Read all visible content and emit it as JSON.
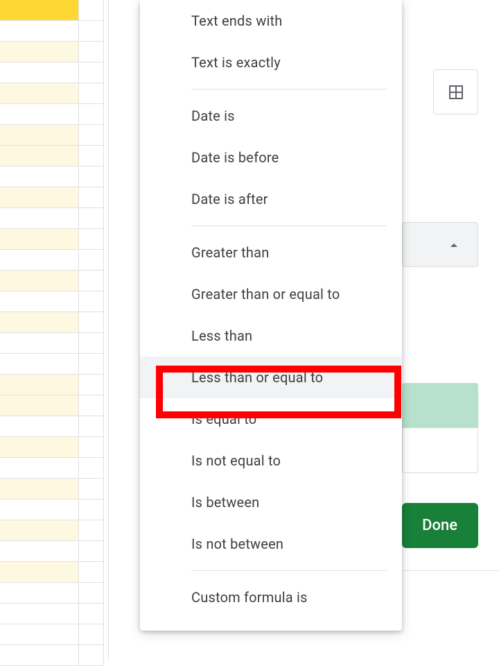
{
  "dropdown": {
    "groups": [
      {
        "items": [
          {
            "id": "text-ends-with",
            "label": "Text ends with"
          },
          {
            "id": "text-is-exactly",
            "label": "Text is exactly"
          }
        ]
      },
      {
        "items": [
          {
            "id": "date-is",
            "label": "Date is"
          },
          {
            "id": "date-is-before",
            "label": "Date is before"
          },
          {
            "id": "date-is-after",
            "label": "Date is after"
          }
        ]
      },
      {
        "items": [
          {
            "id": "greater-than",
            "label": "Greater than"
          },
          {
            "id": "greater-than-or-equal-to",
            "label": "Greater than or equal to"
          },
          {
            "id": "less-than",
            "label": "Less than"
          },
          {
            "id": "less-than-or-equal-to",
            "label": "Less than or equal to",
            "selected": true,
            "annotated": true
          },
          {
            "id": "is-equal-to",
            "label": "Is equal to"
          },
          {
            "id": "is-not-equal-to",
            "label": "Is not equal to"
          },
          {
            "id": "is-between",
            "label": "Is between"
          },
          {
            "id": "is-not-between",
            "label": "Is not between"
          }
        ]
      },
      {
        "items": [
          {
            "id": "custom-formula-is",
            "label": "Custom formula is"
          }
        ]
      }
    ]
  },
  "panel": {
    "done_label": "Done"
  },
  "colors": {
    "accent": "#188038",
    "highlight_cell": "#fff8e1",
    "annotation": "#ff0000",
    "preview_fill": "#b7e1cd"
  }
}
